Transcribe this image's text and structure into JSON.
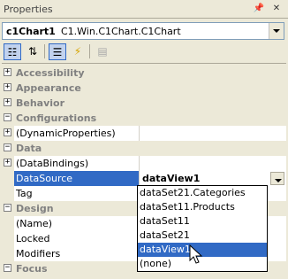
{
  "titlebar": {
    "title": "Properties"
  },
  "object_selector": {
    "name": "c1Chart1",
    "type": "C1.Win.C1Chart.C1Chart"
  },
  "grid": {
    "categories": {
      "accessibility": "Accessibility",
      "appearance": "Appearance",
      "behavior": "Behavior",
      "configurations": "Configurations",
      "data": "Data",
      "design": "Design",
      "focus": "Focus"
    },
    "props": {
      "dynamic_properties": "(DynamicProperties)",
      "data_bindings": "(DataBindings)",
      "data_source": "DataSource",
      "data_source_value": "dataView1",
      "tag": "Tag",
      "name": "(Name)",
      "locked": "Locked",
      "modifiers": "Modifiers"
    }
  },
  "dropdown": {
    "items": [
      "dataSet21.Categories",
      "dataSet11.Products",
      "dataSet11",
      "dataSet21",
      "dataView1",
      "(none)"
    ],
    "selected_index": 4
  }
}
